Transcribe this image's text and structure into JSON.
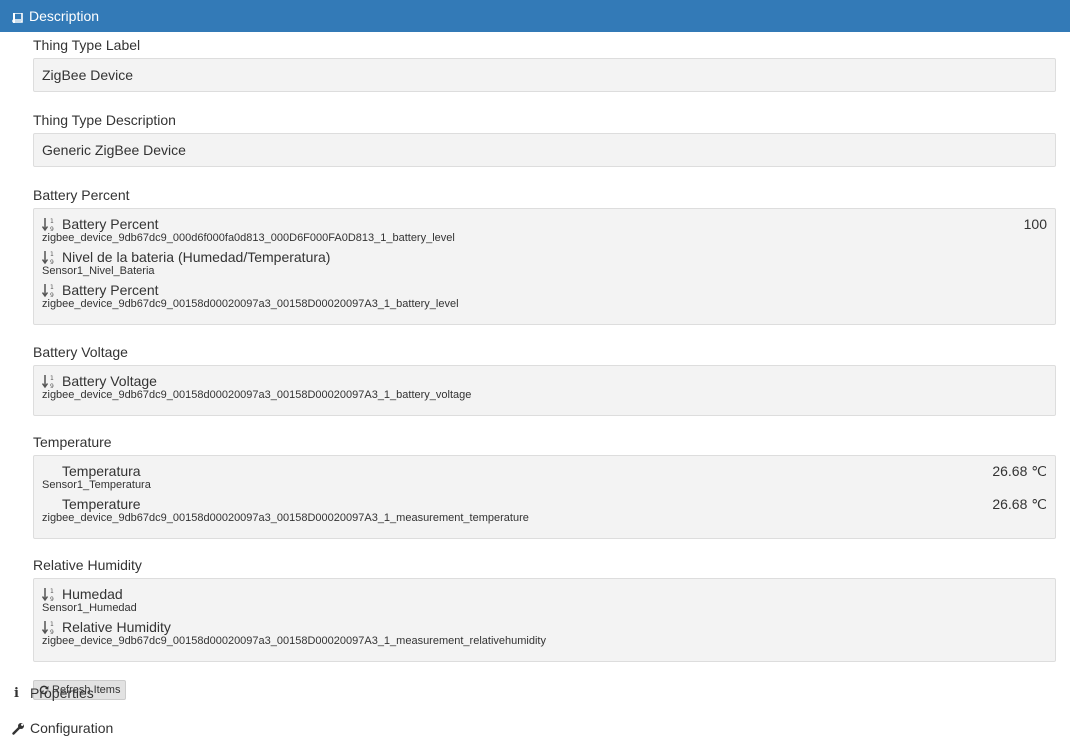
{
  "header": {
    "title": "Description"
  },
  "fields": {
    "thing_type_label": {
      "label": "Thing Type Label",
      "value": "ZigBee Device"
    },
    "thing_type_description": {
      "label": "Thing Type Description",
      "value": "Generic ZigBee Device"
    }
  },
  "channels": {
    "battery_percent": {
      "label": "Battery Percent",
      "items": [
        {
          "title": "Battery Percent",
          "name": "zigbee_device_9db67dc9_000d6f000fa0d813_000D6F000FA0D813_1_battery_level",
          "state": "100"
        },
        {
          "title": "Nivel de la bateria (Humedad/Temperatura)",
          "name": "Sensor1_Nivel_Bateria"
        },
        {
          "title": "Battery Percent",
          "name": "zigbee_device_9db67dc9_00158d00020097a3_00158D00020097A3_1_battery_level"
        }
      ]
    },
    "battery_voltage": {
      "label": "Battery Voltage",
      "items": [
        {
          "title": "Battery Voltage",
          "name": "zigbee_device_9db67dc9_00158d00020097a3_00158D00020097A3_1_battery_voltage"
        }
      ]
    },
    "temperature": {
      "label": "Temperature",
      "items": [
        {
          "title": "Temperatura",
          "name": "Sensor1_Temperatura",
          "state": "26.68 ℃"
        },
        {
          "title": "Temperature",
          "name": "zigbee_device_9db67dc9_00158d00020097a3_00158D00020097A3_1_measurement_temperature",
          "state": "26.68 ℃"
        }
      ]
    },
    "relative_humidity": {
      "label": "Relative Humidity",
      "items": [
        {
          "title": "Humedad",
          "name": "Sensor1_Humedad"
        },
        {
          "title": "Relative Humidity",
          "name": "zigbee_device_9db67dc9_00158d00020097a3_00158D00020097A3_1_measurement_relativehumidity"
        }
      ]
    }
  },
  "actions": {
    "refresh_label": "Refresh Items"
  },
  "sections": {
    "properties": "Properties",
    "configuration": "Configuration"
  },
  "icons": {
    "header": "book-icon",
    "item": "sort-numeric-icon",
    "refresh": "refresh-icon",
    "properties": "info-icon",
    "configuration": "wrench-icon"
  },
  "colors": {
    "header_bg": "#337ab7",
    "box_bg": "#f3f3f3"
  }
}
